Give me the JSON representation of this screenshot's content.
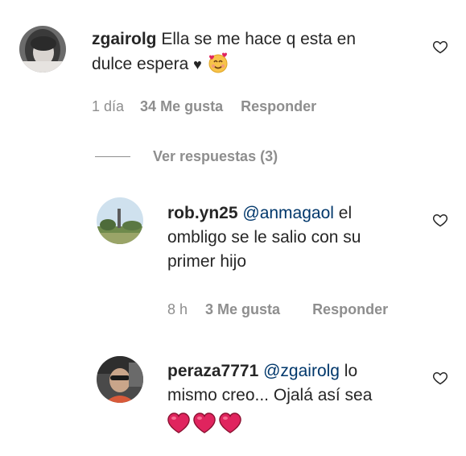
{
  "comments": [
    {
      "username": "zgairolg",
      "text_line1": "Ella se me hace q esta en",
      "text_line2": "dulce espera",
      "time": "1 día",
      "likes": "34 Me gusta",
      "reply": "Responder",
      "view_replies": "Ver respuestas (3)"
    },
    {
      "username": "rob.yn25",
      "mention": "@anmagaol",
      "text_after_mention": " el",
      "text_line2": "ombligo se le salio con su",
      "text_line3": "primer hijo",
      "time": "8 h",
      "likes": "3 Me gusta",
      "reply": "Responder"
    },
    {
      "username": "peraza7771",
      "mention": "@zgairolg",
      "text_after_mention": " lo",
      "text_line2": "mismo creo... Ojalá así sea"
    }
  ],
  "icons": {
    "black_heart": "♥",
    "smiling_face_with_hearts": "smiling-face-with-hearts-emoji",
    "red_heart": "red-heart-emoji",
    "like": "heart-outline-icon"
  },
  "colors": {
    "text": "#262626",
    "secondary": "#8e8e8e",
    "mention": "#00376b",
    "heart_red": "#e0245e"
  }
}
